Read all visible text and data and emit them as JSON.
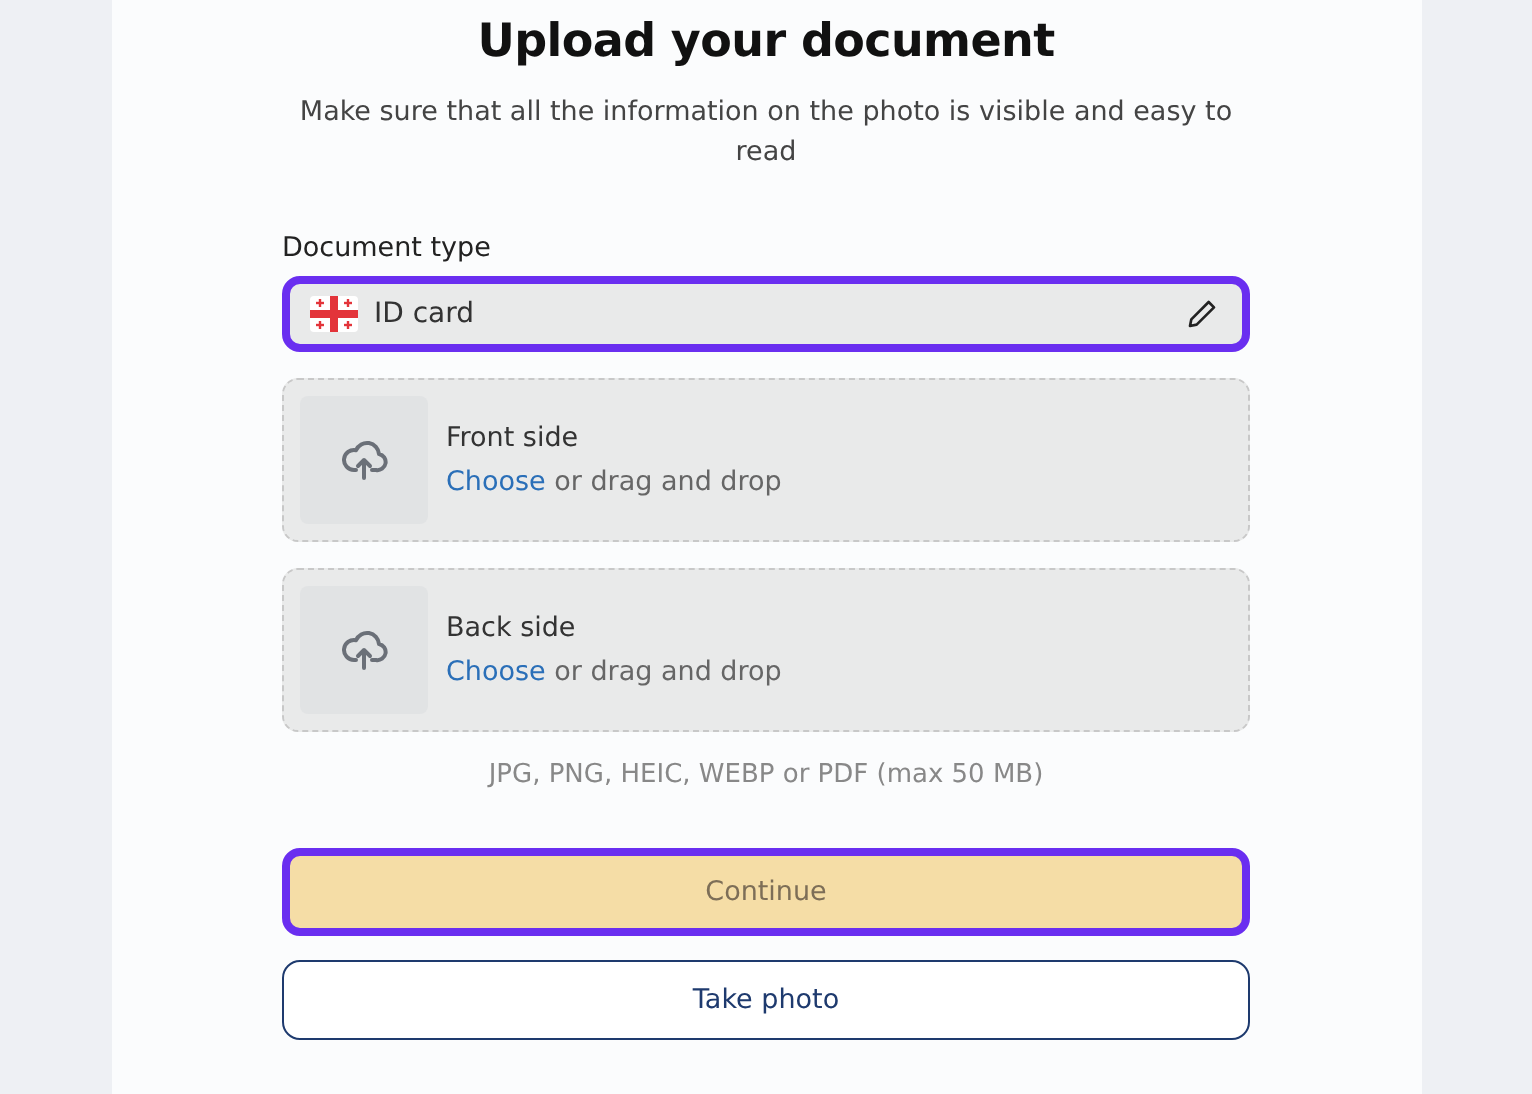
{
  "title": "Upload your document",
  "subtitle": "Make sure that all the information on the photo is visible and easy to read",
  "document_type": {
    "label": "Document type",
    "value": "ID card",
    "highlighted": true
  },
  "uploads": [
    {
      "title": "Front side",
      "link": "Choose",
      "hint": "or drag and drop"
    },
    {
      "title": "Back side",
      "link": "Choose",
      "hint": "or drag and drop"
    }
  ],
  "formats": "JPG, PNG, HEIC, WEBP or PDF (max 50 MB)",
  "buttons": [
    {
      "label": "Continue",
      "kind": "primary",
      "highlighted": true
    },
    {
      "label": "Take photo",
      "kind": "outline",
      "highlighted": false
    }
  ]
}
